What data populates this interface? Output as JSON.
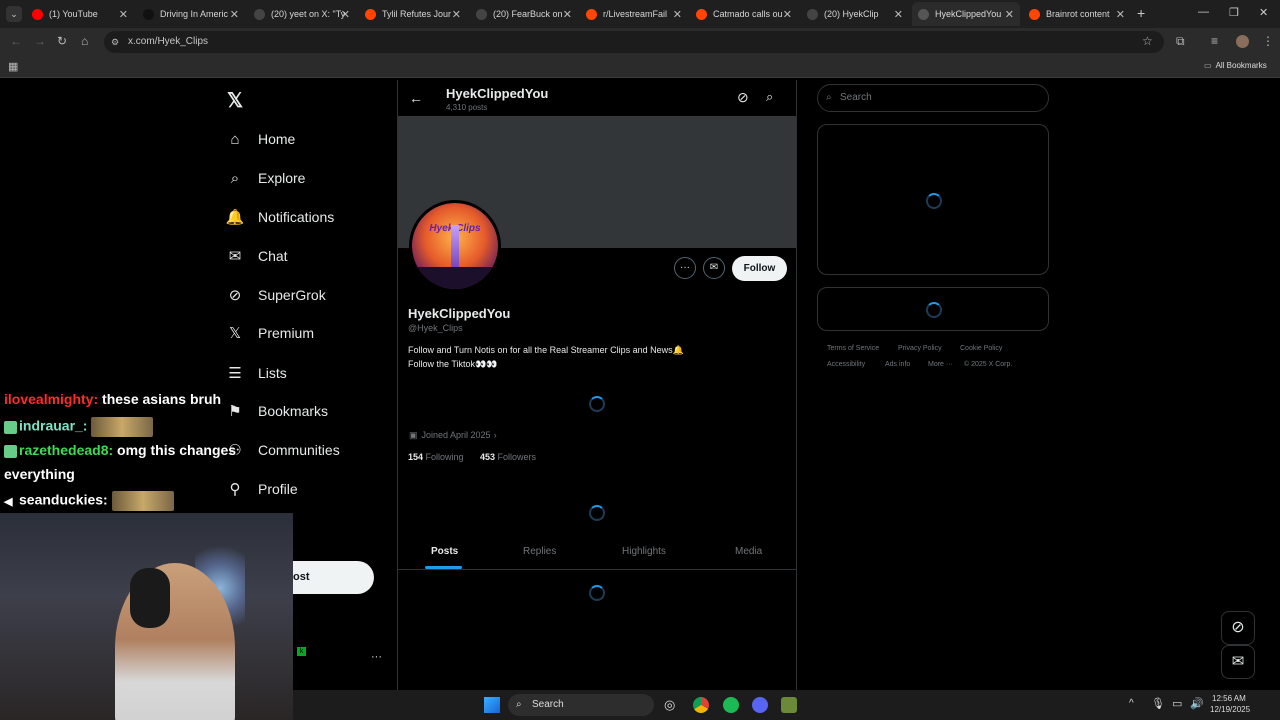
{
  "browser": {
    "tabs": [
      {
        "title": "(1) YouTube",
        "fav": "#ff0000"
      },
      {
        "title": "Driving In Americ",
        "fav": "#111111"
      },
      {
        "title": "(20) yeet on X: \"Ty",
        "fav": "#444444"
      },
      {
        "title": "Tylil Refutes Jour",
        "fav": "#ff4500"
      },
      {
        "title": "(20) FearBuck on",
        "fav": "#444444"
      },
      {
        "title": "r/LivestreamFail",
        "fav": "#ff4500"
      },
      {
        "title": "Catmado calls ou",
        "fav": "#ff4500"
      },
      {
        "title": "(20) HyekClip",
        "fav": "#444444"
      },
      {
        "title": "HyekClippedYou",
        "fav": "#555555"
      },
      {
        "title": "Brainrot content",
        "fav": "#ff4500"
      }
    ],
    "new_tab": "+",
    "url": "x.com/Hyek_Clips",
    "all_bookmarks": "All Bookmarks"
  },
  "nav": {
    "items": [
      {
        "label": "Home",
        "icon": "home-icon"
      },
      {
        "label": "Explore",
        "icon": "search-icon"
      },
      {
        "label": "Notifications",
        "icon": "bell-icon"
      },
      {
        "label": "Chat",
        "icon": "mail-icon"
      },
      {
        "label": "SuperGrok",
        "icon": "grok-icon"
      },
      {
        "label": "Premium",
        "icon": "x-icon"
      },
      {
        "label": "Lists",
        "icon": "list-icon"
      },
      {
        "label": "Bookmarks",
        "icon": "bookmark-icon"
      },
      {
        "label": "Communities",
        "icon": "people-icon"
      },
      {
        "label": "Profile",
        "icon": "person-icon"
      }
    ],
    "post_button": "ost",
    "more": "···"
  },
  "profile": {
    "header_name": "HyekClippedYou",
    "header_posts": "4,310 posts",
    "name": "HyekClippedYou",
    "handle": "@Hyek_Clips",
    "bio_line1": "Follow and Turn Notis on for all the Real Streamer Clips and News🔔",
    "bio_line2": "Follow the Tiktok👀👀",
    "joined": "Joined April 2025",
    "following_count": "154",
    "following_label": "Following",
    "followers_count": "453",
    "followers_label": "Followers",
    "follow_button": "Follow",
    "avatar_text": "Hyek Clips",
    "tabs": [
      "Posts",
      "Replies",
      "Highlights",
      "Media"
    ]
  },
  "right": {
    "search_placeholder": "Search",
    "footer": [
      "Terms of Service",
      "Privacy Policy",
      "Cookie Policy",
      "Accessibility",
      "Ads info",
      "More ···",
      "© 2025 X Corp."
    ]
  },
  "chat": [
    {
      "user": "ilovealmighty:",
      "color": "#ff2a2a",
      "text": "these asians bruh"
    },
    {
      "user": "indrauar_:",
      "color": "#7fe3c6",
      "text": ""
    },
    {
      "user": "razethedead8:",
      "color": "#3adb55",
      "text": "omg this changes"
    },
    {
      "user": "",
      "color": "#ffffff",
      "text": "everything"
    },
    {
      "user": "seanduckies:",
      "color": "#ffffff",
      "text": ""
    }
  ],
  "taskbar": {
    "search": "Search",
    "time": "12:56 AM",
    "date": "12/19/2025"
  }
}
